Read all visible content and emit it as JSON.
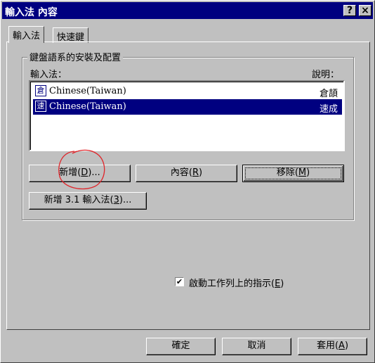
{
  "window": {
    "title": "輸入法 內容",
    "help_label": "?",
    "close_label": "×"
  },
  "tabs": [
    {
      "label": "輸入法"
    },
    {
      "label": "快速鍵"
    }
  ],
  "group": {
    "title": "鍵盤語系的安裝及配置",
    "list_header_left": "輸入法：",
    "list_header_right": "說明：",
    "items": [
      {
        "icon": "倉",
        "name": "Chinese(Taiwan)",
        "desc": "倉頡",
        "selected": false
      },
      {
        "icon": "速",
        "name": "Chinese(Taiwan)",
        "desc": "速成",
        "selected": true
      }
    ],
    "buttons": {
      "add": {
        "text": "新增(",
        "mnemonic": "D",
        "suffix": ")..."
      },
      "props": {
        "text": "內容(",
        "mnemonic": "R",
        "suffix": ")"
      },
      "remove": {
        "text": "移除(",
        "mnemonic": "M",
        "suffix": ")"
      },
      "add31": {
        "text": "新增 3.1 輸入法(",
        "mnemonic": "3",
        "suffix": ")..."
      }
    }
  },
  "indicator": {
    "checked": true,
    "check_glyph": "✔",
    "text": "啟動工作列上的指示(",
    "mnemonic": "E",
    "suffix": ")"
  },
  "footer": {
    "ok": "確定",
    "cancel": "取消",
    "apply": {
      "text": "套用(",
      "mnemonic": "A",
      "suffix": ")"
    }
  },
  "colors": {
    "titlebar": "#000080",
    "face": "#c0c0c0",
    "selection": "#000080",
    "annotation": "#e0252a"
  }
}
